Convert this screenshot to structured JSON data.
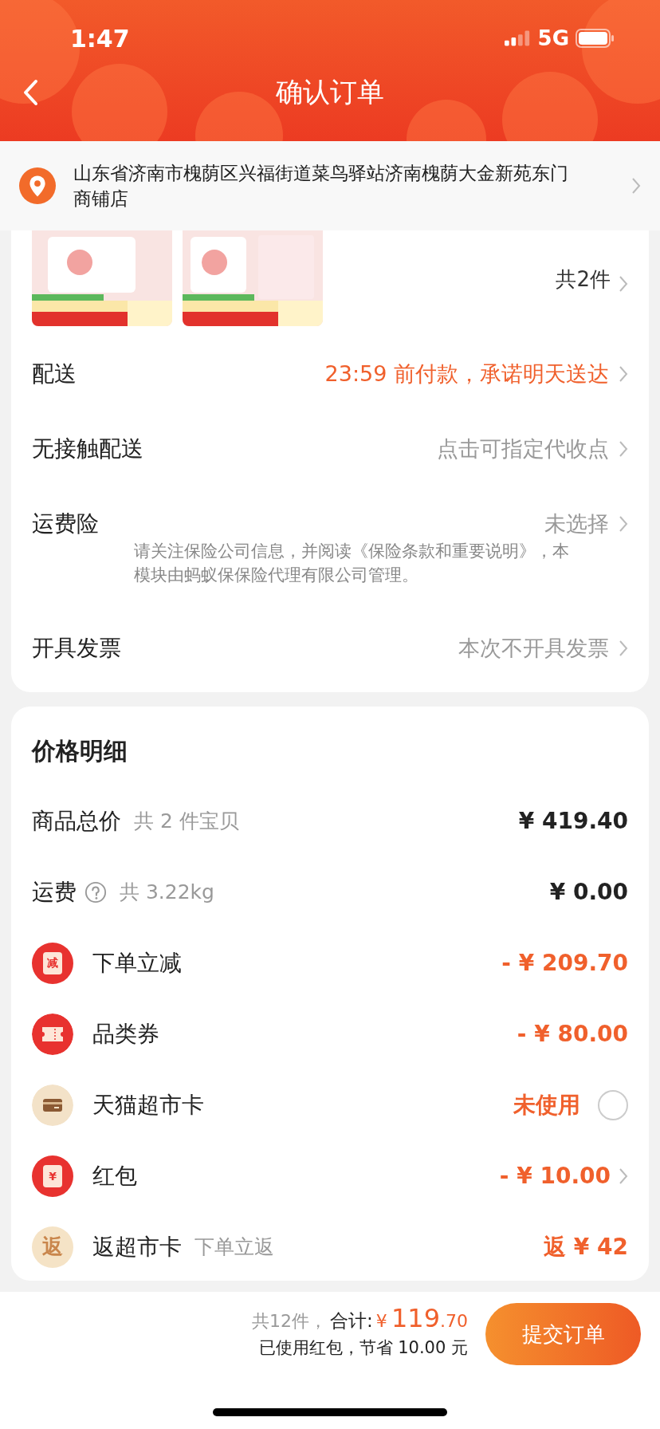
{
  "status_bar": {
    "time": "1:47",
    "network": "5G"
  },
  "nav": {
    "title": "确认订单"
  },
  "address": {
    "text": "山东省济南市槐荫区兴福街道菜鸟驿站济南槐荫大金新苑东门商铺店"
  },
  "goods": {
    "count": "共2件"
  },
  "options": [
    {
      "label": "配送",
      "value": "23:59 前付款，承诺明天送达",
      "kind": "accent"
    },
    {
      "label": "无接触配送",
      "value": "点击可指定代收点",
      "kind": "muted"
    },
    {
      "label": "运费险",
      "value": "未选择",
      "kind": "muted",
      "note": "请关注保险公司信息，并阅读《保险条款和重要说明》，本模块由蚂蚁保保险代理有限公司管理。"
    },
    {
      "label": "开具发票",
      "value": "本次不开具发票",
      "kind": "muted"
    }
  ],
  "price_detail": {
    "title": "价格明细",
    "rows": [
      {
        "kind": "plain",
        "label": "商品总价",
        "sub": "共 2 件宝贝",
        "amount": "¥ 419.40"
      },
      {
        "kind": "help",
        "label": "运费",
        "sub": "共 3.22kg",
        "amount": "¥ 0.00"
      },
      {
        "kind": "envelope",
        "icon_text": "减",
        "label": "下单立减",
        "amount": "- ¥ 209.70"
      },
      {
        "kind": "ticket",
        "label": "品类券",
        "amount": "- ¥ 80.00"
      },
      {
        "kind": "card",
        "label": "天猫超市卡",
        "amount": "未使用",
        "checked": false
      },
      {
        "kind": "envelope",
        "icon_text": "¥",
        "label": "红包",
        "amount": "- ¥ 10.00",
        "arrow": true
      },
      {
        "kind": "badge",
        "icon_text": "返",
        "label": "返超市卡",
        "sub": "下单立返",
        "amount": "返 ¥ 42"
      }
    ]
  },
  "bottom_bar": {
    "count": "共12件，",
    "total_label": "合计:",
    "currency": "¥",
    "total_int": "119",
    "total_dec": ".70",
    "note": "已使用红包，节省 10.00 元",
    "submit": "提交订单"
  }
}
